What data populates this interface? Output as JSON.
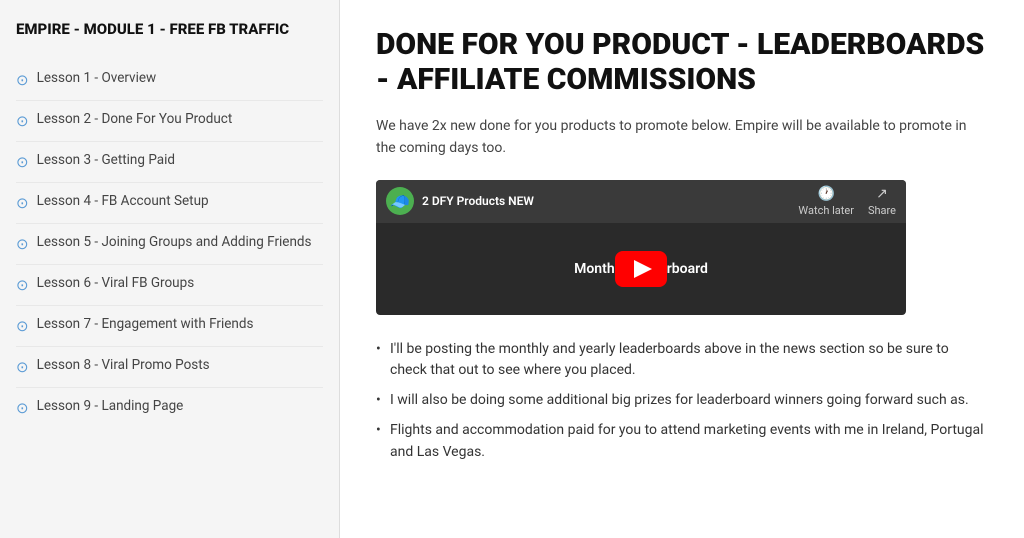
{
  "sidebar": {
    "title": "EMPIRE - MODULE 1 - FREE FB TRAFFIC",
    "items": [
      {
        "id": "lesson-1",
        "label": "Lesson 1 - Overview"
      },
      {
        "id": "lesson-2",
        "label": "Lesson 2 - Done For You Product"
      },
      {
        "id": "lesson-3",
        "label": "Lesson 3 - Getting Paid"
      },
      {
        "id": "lesson-4",
        "label": "Lesson 4 - FB Account Setup"
      },
      {
        "id": "lesson-5",
        "label": "Lesson 5 - Joining Groups and Adding Friends"
      },
      {
        "id": "lesson-6",
        "label": "Lesson 6 - Viral FB Groups"
      },
      {
        "id": "lesson-7",
        "label": "Lesson 7 - Engagement with Friends"
      },
      {
        "id": "lesson-8",
        "label": "Lesson 8 - Viral Promo Posts"
      },
      {
        "id": "lesson-9",
        "label": "Lesson 9 - Landing Page"
      }
    ]
  },
  "main": {
    "title": "DONE FOR YOU PRODUCT - LEADERBOARDS - AFFILIATE COMMISSIONS",
    "description": "We have 2x new done for you products to promote below. Empire will be available to promote in the coming days too.",
    "video": {
      "channel_name": "2 DFY Products NEW",
      "title_overlay": "Monthly Leaderboard",
      "watch_later": "Watch later",
      "share": "Share"
    },
    "bullets": [
      "I'll be posting the monthly and yearly leaderboards above in the news section so be sure to check that out to see where you placed.",
      "I will also be doing some additional big prizes for leaderboard winners going forward such as.",
      "Flights and accommodation paid for you to attend marketing events with me in Ireland, Portugal and Las Vegas."
    ]
  }
}
